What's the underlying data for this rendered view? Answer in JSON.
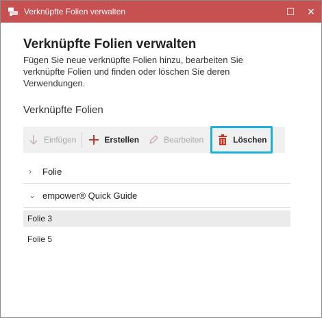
{
  "window": {
    "title": "Verknüpfte Folien verwalten",
    "titlebar_color": "#c75050",
    "maximize_glyph": "☐",
    "close_glyph": "✕"
  },
  "header": {
    "title": "Verknüpfte Folien verwalten",
    "description": "Fügen Sie neue verknüpfte Folien hinzu, bearbeiten Sie verknüpfte Folien und finden oder löschen Sie deren Verwendungen."
  },
  "section": {
    "title": "Verknüpfte Folien"
  },
  "toolbar": {
    "insert_label": "Einfügen",
    "create_label": "Erstellen",
    "edit_label": "Bearbeiten",
    "delete_label": "Löschen",
    "highlight_color": "#1ab0da",
    "accent_color": "#c0392b"
  },
  "tree": {
    "groups": [
      {
        "label": "Folie",
        "expanded": false,
        "chevron": "›"
      },
      {
        "label": "empower® Quick Guide",
        "expanded": true,
        "chevron": "⌄",
        "children": [
          {
            "label": "Folie 3",
            "selected": true
          },
          {
            "label": "Folie 5",
            "selected": false
          }
        ]
      }
    ]
  }
}
